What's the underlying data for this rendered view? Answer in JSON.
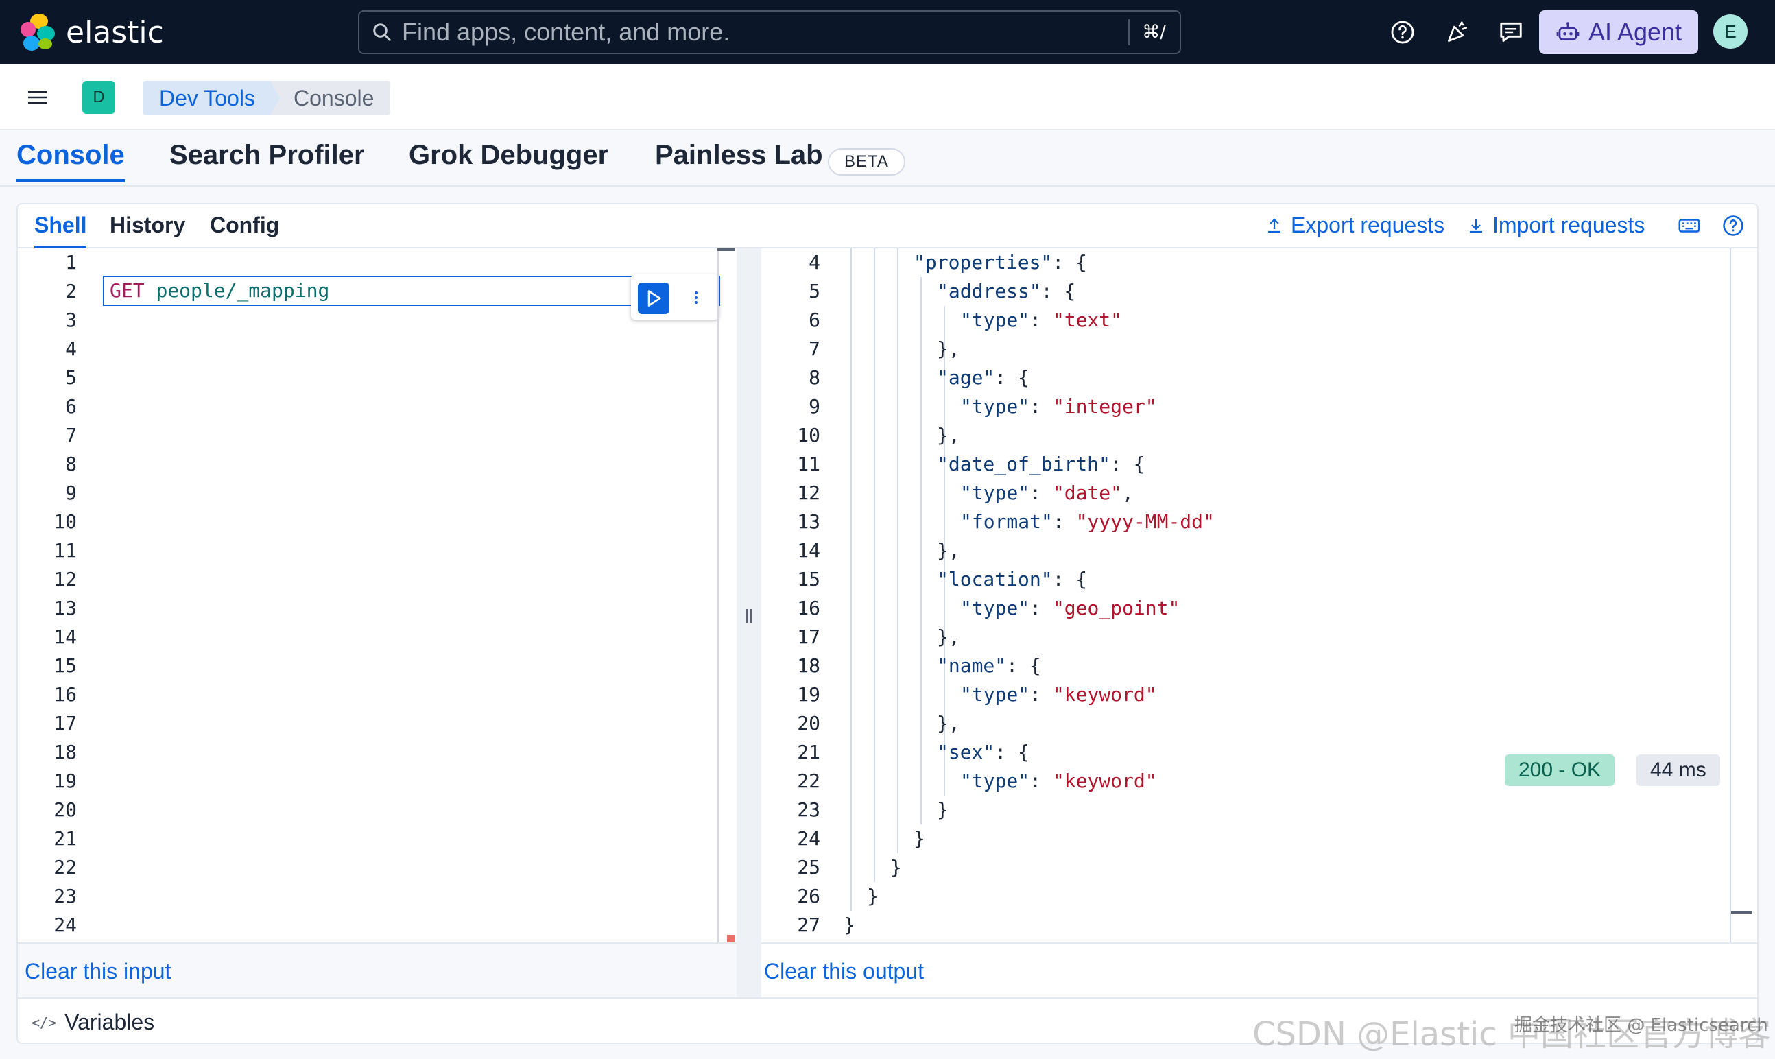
{
  "header": {
    "brand": "elastic",
    "search_placeholder": "Find apps, content, and more.",
    "search_shortcut": "⌘/",
    "ai_agent_label": "AI Agent",
    "avatar_initial": "E"
  },
  "breadcrumb": {
    "space_initial": "D",
    "items": [
      "Dev Tools",
      "Console"
    ]
  },
  "app_tabs": {
    "items": [
      "Console",
      "Search Profiler",
      "Grok Debugger",
      "Painless Lab"
    ],
    "active": "Console",
    "beta_badge": "BETA"
  },
  "console": {
    "sub_tabs": [
      "Shell",
      "History",
      "Config"
    ],
    "active_sub_tab": "Shell",
    "export_label": "Export requests",
    "import_label": "Import requests",
    "input": {
      "method": "GET",
      "path": "people/_mapping",
      "line_numbers": [
        "1",
        "2",
        "3",
        "4",
        "5",
        "6",
        "7",
        "8",
        "9",
        "10",
        "11",
        "12",
        "13",
        "14",
        "15",
        "16",
        "17",
        "18",
        "19",
        "20",
        "21",
        "22",
        "23",
        "24"
      ],
      "clear_label": "Clear this input"
    },
    "output": {
      "line_numbers": [
        "4",
        "5",
        "6",
        "7",
        "8",
        "9",
        "10",
        "11",
        "12",
        "13",
        "14",
        "15",
        "16",
        "17",
        "18",
        "19",
        "20",
        "21",
        "22",
        "23",
        "24",
        "25",
        "26",
        "27"
      ],
      "clear_label": "Clear this output",
      "status": "200 - OK",
      "time": "44 ms",
      "lines": [
        {
          "indent": 3,
          "key": "properties",
          "rest": ": {"
        },
        {
          "indent": 4,
          "key": "address",
          "rest": ": {"
        },
        {
          "indent": 5,
          "key": "type",
          "value": "text"
        },
        {
          "indent": 4,
          "text": "},"
        },
        {
          "indent": 4,
          "key": "age",
          "rest": ": {"
        },
        {
          "indent": 5,
          "key": "type",
          "value": "integer"
        },
        {
          "indent": 4,
          "text": "},"
        },
        {
          "indent": 4,
          "key": "date_of_birth",
          "rest": ": {"
        },
        {
          "indent": 5,
          "key": "type",
          "value": "date",
          "trail": ","
        },
        {
          "indent": 5,
          "key": "format",
          "value": "yyyy-MM-dd"
        },
        {
          "indent": 4,
          "text": "},"
        },
        {
          "indent": 4,
          "key": "location",
          "rest": ": {"
        },
        {
          "indent": 5,
          "key": "type",
          "value": "geo_point"
        },
        {
          "indent": 4,
          "text": "},"
        },
        {
          "indent": 4,
          "key": "name",
          "rest": ": {"
        },
        {
          "indent": 5,
          "key": "type",
          "value": "keyword"
        },
        {
          "indent": 4,
          "text": "},"
        },
        {
          "indent": 4,
          "key": "sex",
          "rest": ": {"
        },
        {
          "indent": 5,
          "key": "type",
          "value": "keyword"
        },
        {
          "indent": 4,
          "text": "}"
        },
        {
          "indent": 3,
          "text": "}"
        },
        {
          "indent": 2,
          "text": "}"
        },
        {
          "indent": 1,
          "text": "}"
        },
        {
          "indent": 0,
          "text": "}"
        }
      ]
    },
    "variables_label": "Variables"
  },
  "watermark": {
    "csdn": "CSDN @Elastic 中国社区官方博客",
    "juejin": "掘金技术社区 @ Elasticsearch"
  },
  "colors": {
    "accent": "#0b64dd",
    "header_bg": "#0b1628",
    "status_ok_bg": "#ace6d3",
    "json_key": "#0e3b76",
    "json_string": "#b2142d"
  }
}
